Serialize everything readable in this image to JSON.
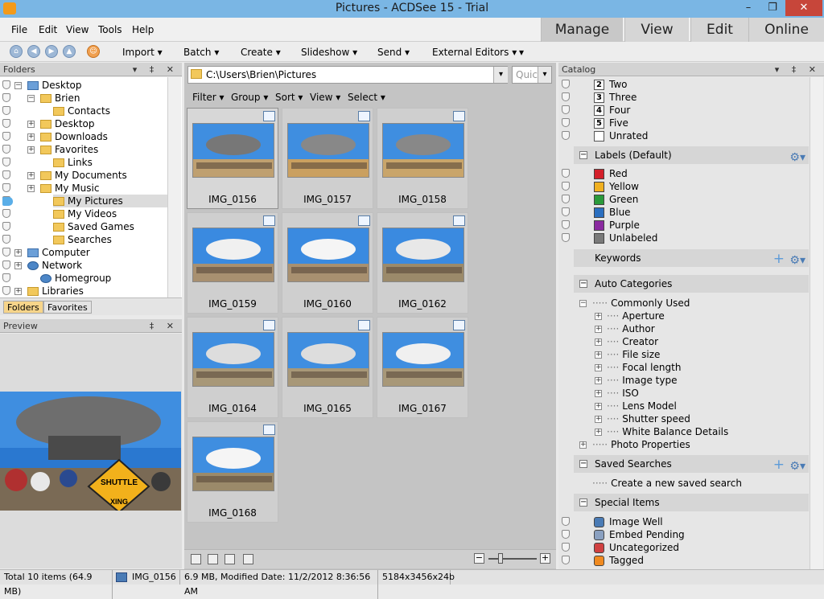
{
  "window": {
    "title": "Pictures - ACDSee 15 - Trial",
    "min": "–",
    "max": "❐",
    "close": "✕"
  },
  "menu": [
    "File",
    "Edit",
    "View",
    "Tools",
    "Help"
  ],
  "modes": {
    "manage": "Manage",
    "view": "View",
    "edit": "Edit",
    "online": "Online"
  },
  "toolbar": {
    "import": "Import",
    "batch": "Batch",
    "create": "Create",
    "slideshow": "Slideshow",
    "send": "Send",
    "external": "External Editors"
  },
  "folders": {
    "header": "Folders",
    "tree": [
      {
        "label": "Desktop",
        "type": "pc"
      },
      {
        "label": "Brien",
        "type": "folder"
      },
      {
        "label": "Contacts",
        "type": "folder"
      },
      {
        "label": "Desktop",
        "type": "folder"
      },
      {
        "label": "Downloads",
        "type": "folder"
      },
      {
        "label": "Favorites",
        "type": "folder"
      },
      {
        "label": "Links",
        "type": "folder"
      },
      {
        "label": "My Documents",
        "type": "folder"
      },
      {
        "label": "My Music",
        "type": "folder"
      },
      {
        "label": "My Pictures",
        "type": "folder",
        "selected": true
      },
      {
        "label": "My Videos",
        "type": "folder"
      },
      {
        "label": "Saved Games",
        "type": "folder"
      },
      {
        "label": "Searches",
        "type": "folder"
      },
      {
        "label": "Computer",
        "type": "pc"
      },
      {
        "label": "Network",
        "type": "net"
      },
      {
        "label": "Homegroup",
        "type": "net"
      },
      {
        "label": "Libraries",
        "type": "folder"
      }
    ],
    "tabs": {
      "folders": "Folders",
      "favorites": "Favorites"
    }
  },
  "preview": {
    "header": "Preview",
    "sign_line1": "SHUTTLE",
    "sign_line2": "XING"
  },
  "browser": {
    "path": "C:\\Users\\Brien\\Pictures",
    "quick": "Quic",
    "filters": [
      "Filter",
      "Group",
      "Sort",
      "View",
      "Select"
    ],
    "items": [
      "IMG_0156",
      "IMG_0157",
      "IMG_0158",
      "IMG_0159",
      "IMG_0160",
      "IMG_0162",
      "IMG_0164",
      "IMG_0165",
      "IMG_0167",
      "IMG_0168"
    ]
  },
  "catalog": {
    "header": "Catalog",
    "ratings": [
      {
        "num": "2",
        "label": "Two"
      },
      {
        "num": "3",
        "label": "Three"
      },
      {
        "num": "4",
        "label": "Four"
      },
      {
        "num": "5",
        "label": "Five"
      },
      {
        "num": "",
        "label": "Unrated"
      }
    ],
    "labels_header": "Labels (Default)",
    "labels": [
      {
        "label": "Red",
        "color": "#d4202a"
      },
      {
        "label": "Yellow",
        "color": "#f0b020"
      },
      {
        "label": "Green",
        "color": "#2a9a3a"
      },
      {
        "label": "Blue",
        "color": "#2a6fc0"
      },
      {
        "label": "Purple",
        "color": "#8a2aa0"
      },
      {
        "label": "Unlabeled",
        "color": "#7a7a7a"
      }
    ],
    "keywords": "Keywords",
    "auto_header": "Auto Categories",
    "commonly_used": "Commonly Used",
    "auto_items": [
      "Aperture",
      "Author",
      "Creator",
      "File size",
      "Focal length",
      "Image type",
      "ISO",
      "Lens Model",
      "Shutter speed",
      "White Balance Details"
    ],
    "photo_props": "Photo Properties",
    "saved_header": "Saved Searches",
    "saved_create": "Create a new saved search",
    "special_header": "Special Items",
    "special_items": [
      "Image Well",
      "Embed Pending",
      "Uncategorized",
      "Tagged"
    ]
  },
  "status": {
    "total": "Total 10 items  (64.9 MB)",
    "file": "IMG_0156",
    "info": "6.9 MB, Modified Date: 11/2/2012 8:36:56 AM",
    "dims": "5184x3456x24b"
  }
}
